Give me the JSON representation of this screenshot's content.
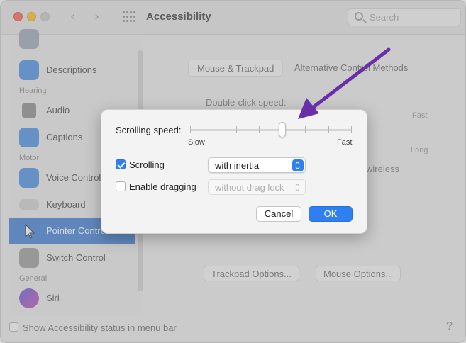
{
  "window": {
    "title": "Accessibility",
    "search_placeholder": "Search"
  },
  "sidebar": {
    "items": [
      {
        "label": "Descriptions",
        "icon": "descriptions-icon"
      },
      {
        "label": "Audio",
        "icon": "speaker-icon"
      },
      {
        "label": "Captions",
        "icon": "captions-icon"
      },
      {
        "label": "Voice Control",
        "icon": "voice-control-icon"
      },
      {
        "label": "Keyboard",
        "icon": "keyboard-icon"
      },
      {
        "label": "Pointer Control",
        "icon": "pointer-icon",
        "selected": true
      },
      {
        "label": "Switch Control",
        "icon": "switch-control-icon"
      },
      {
        "label": "Siri",
        "icon": "siri-icon"
      }
    ],
    "sections": {
      "hearing": "Hearing",
      "motor": "Motor",
      "general": "General"
    }
  },
  "content": {
    "tabs": [
      {
        "label": "Mouse & Trackpad",
        "active": true
      },
      {
        "label": "Alternative Control Methods",
        "active": false
      }
    ],
    "double_click_label": "Double-click speed:",
    "fast_label": "Fast",
    "long_label": "Long",
    "wireless_fragment": "wireless",
    "trackpad_options": "Trackpad Options...",
    "mouse_options": "Mouse Options..."
  },
  "bottom": {
    "status_checkbox_label": "Show Accessibility status in menu bar",
    "help": "?"
  },
  "dialog": {
    "scrolling_speed_label": "Scrolling speed:",
    "slider": {
      "min_label": "Slow",
      "max_label": "Fast",
      "ticks": 8,
      "value_fraction": 0.57
    },
    "options": [
      {
        "label": "Scrolling",
        "checked": true,
        "popup_value": "with inertia",
        "popup_enabled": true
      },
      {
        "label": "Enable dragging",
        "checked": false,
        "popup_value": "without drag lock",
        "popup_enabled": false
      }
    ],
    "cancel_label": "Cancel",
    "ok_label": "OK"
  },
  "colors": {
    "accent": "#2f7ff0",
    "annotation_arrow": "#6a2fa8",
    "sidebar_selected": "#3f7fd6"
  }
}
